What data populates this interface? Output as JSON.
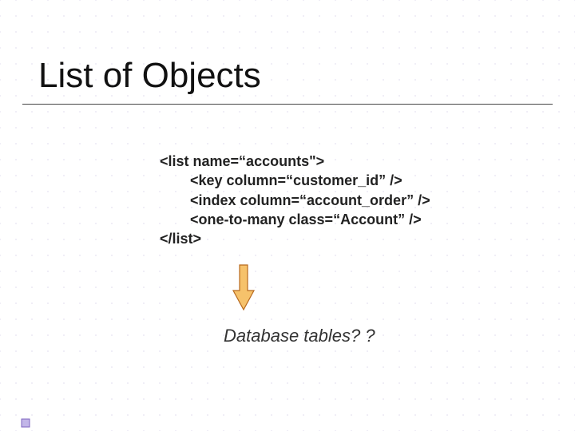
{
  "title": "List of Objects",
  "code": {
    "line1": "<list name=“accounts\">",
    "line2": "<key column=“customer_id” />",
    "line3": "<index column=“account_order” />",
    "line4": "<one-to-many class=“Account” />",
    "line5": "</list>"
  },
  "caption": "Database tables? ?",
  "colors": {
    "arrow_fill": "#F6C26B",
    "arrow_stroke": "#B86A1E",
    "bullet_fill": "#C2B6E8",
    "bullet_stroke": "#7E64C0"
  }
}
